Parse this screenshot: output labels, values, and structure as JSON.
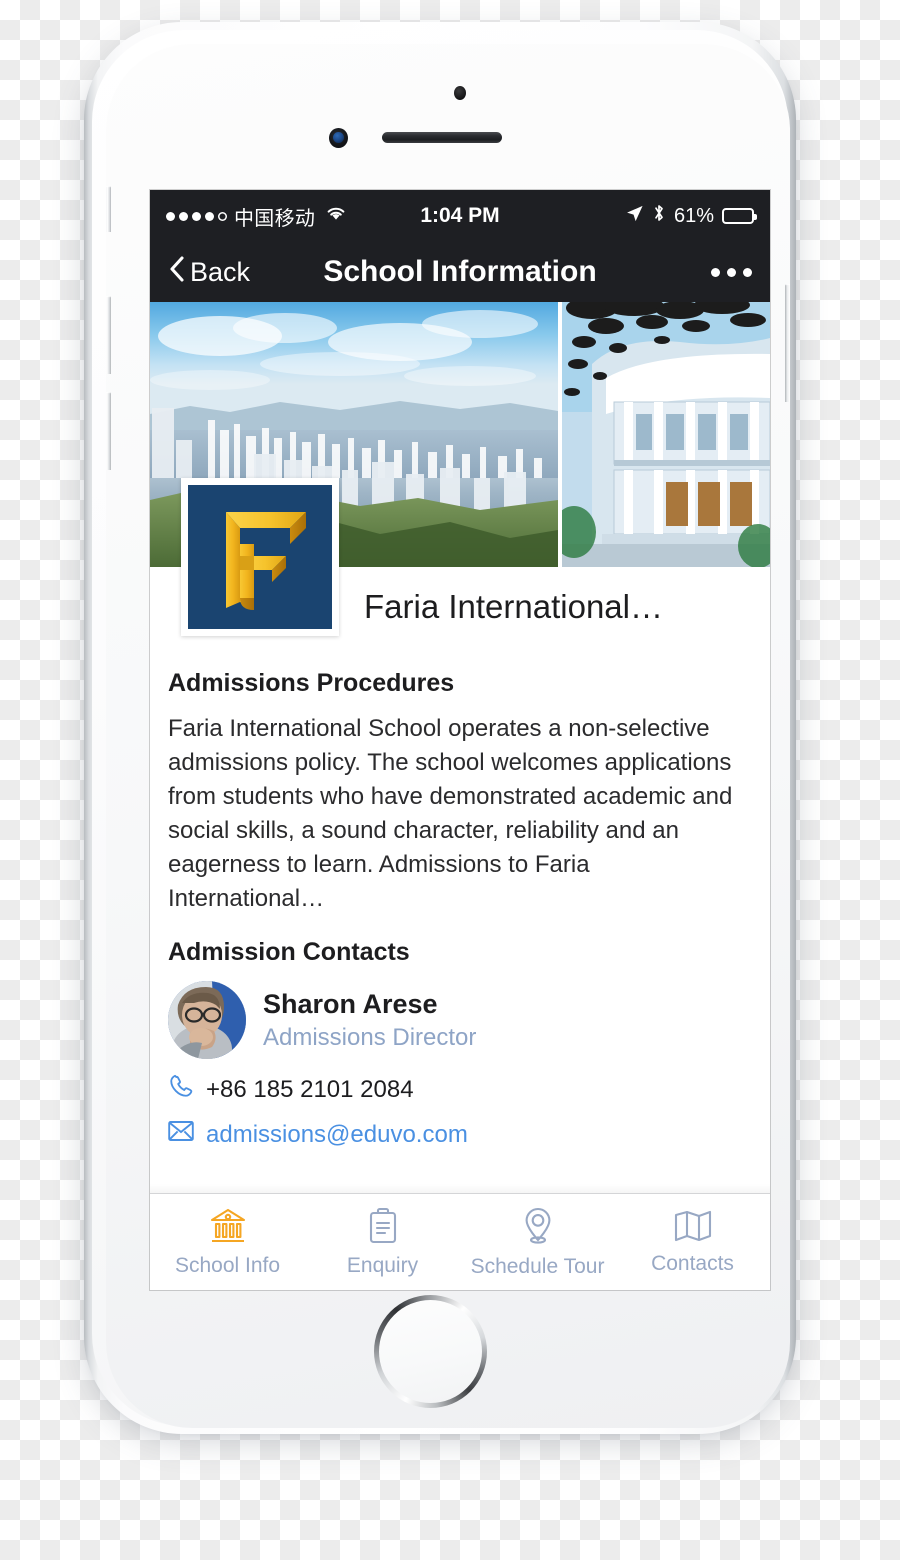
{
  "status_bar": {
    "signal_dots_filled": 4,
    "signal_dots_total": 5,
    "carrier": "中国移动",
    "wifi_icon": "wifi-icon",
    "time": "1:04 PM",
    "location_icon": "location-arrow-icon",
    "bluetooth_icon": "bluetooth-icon",
    "battery_percent": "61%",
    "battery_level": 61
  },
  "nav_bar": {
    "back_label": "Back",
    "back_icon": "chevron-left-icon",
    "title": "School Information",
    "more_icon": "ellipsis-icon"
  },
  "hero": {
    "photo_left": "hong-kong-skyline-photo",
    "photo_right": "school-building-photo"
  },
  "school": {
    "logo_letter": "F",
    "logo_bg": "#1a4470",
    "logo_fg": "#f5c02a",
    "name": "Faria International…"
  },
  "sections": {
    "admissions_procedures": {
      "heading": "Admissions Procedures",
      "body": "Faria International School operates a non-selective admissions policy. The school welcomes applications from students who have demonstrated academic and social skills, a sound character, reliability and an eagerness to learn. Admissions to Faria International…"
    },
    "admission_contacts": {
      "heading": "Admission Contacts",
      "person": {
        "avatar": "contact-avatar-photo",
        "name": "Sharon Arese",
        "role": "Admissions Director"
      },
      "phone": {
        "icon": "phone-icon",
        "value": "+86 185 2101 2084"
      },
      "email": {
        "icon": "envelope-icon",
        "value": "admissions@eduvo.com"
      }
    }
  },
  "tab_bar": {
    "active_index": 0,
    "active_color": "#f5a623",
    "inactive_color": "#98a8c4",
    "items": [
      {
        "label": "School Info",
        "icon": "bank-building-icon"
      },
      {
        "label": "Enquiry",
        "icon": "clipboard-icon"
      },
      {
        "label": "Schedule Tour",
        "icon": "location-pin-icon"
      },
      {
        "label": "Contacts",
        "icon": "map-icon"
      }
    ]
  },
  "device": {
    "proximity_sensor": "proximity-sensor",
    "front_camera": "front-camera",
    "earpiece": "earpiece-speaker",
    "home_button": "home-button",
    "mute_switch": "mute-switch",
    "volume_up": "volume-up-button",
    "volume_down": "volume-down-button",
    "power": "power-button"
  }
}
